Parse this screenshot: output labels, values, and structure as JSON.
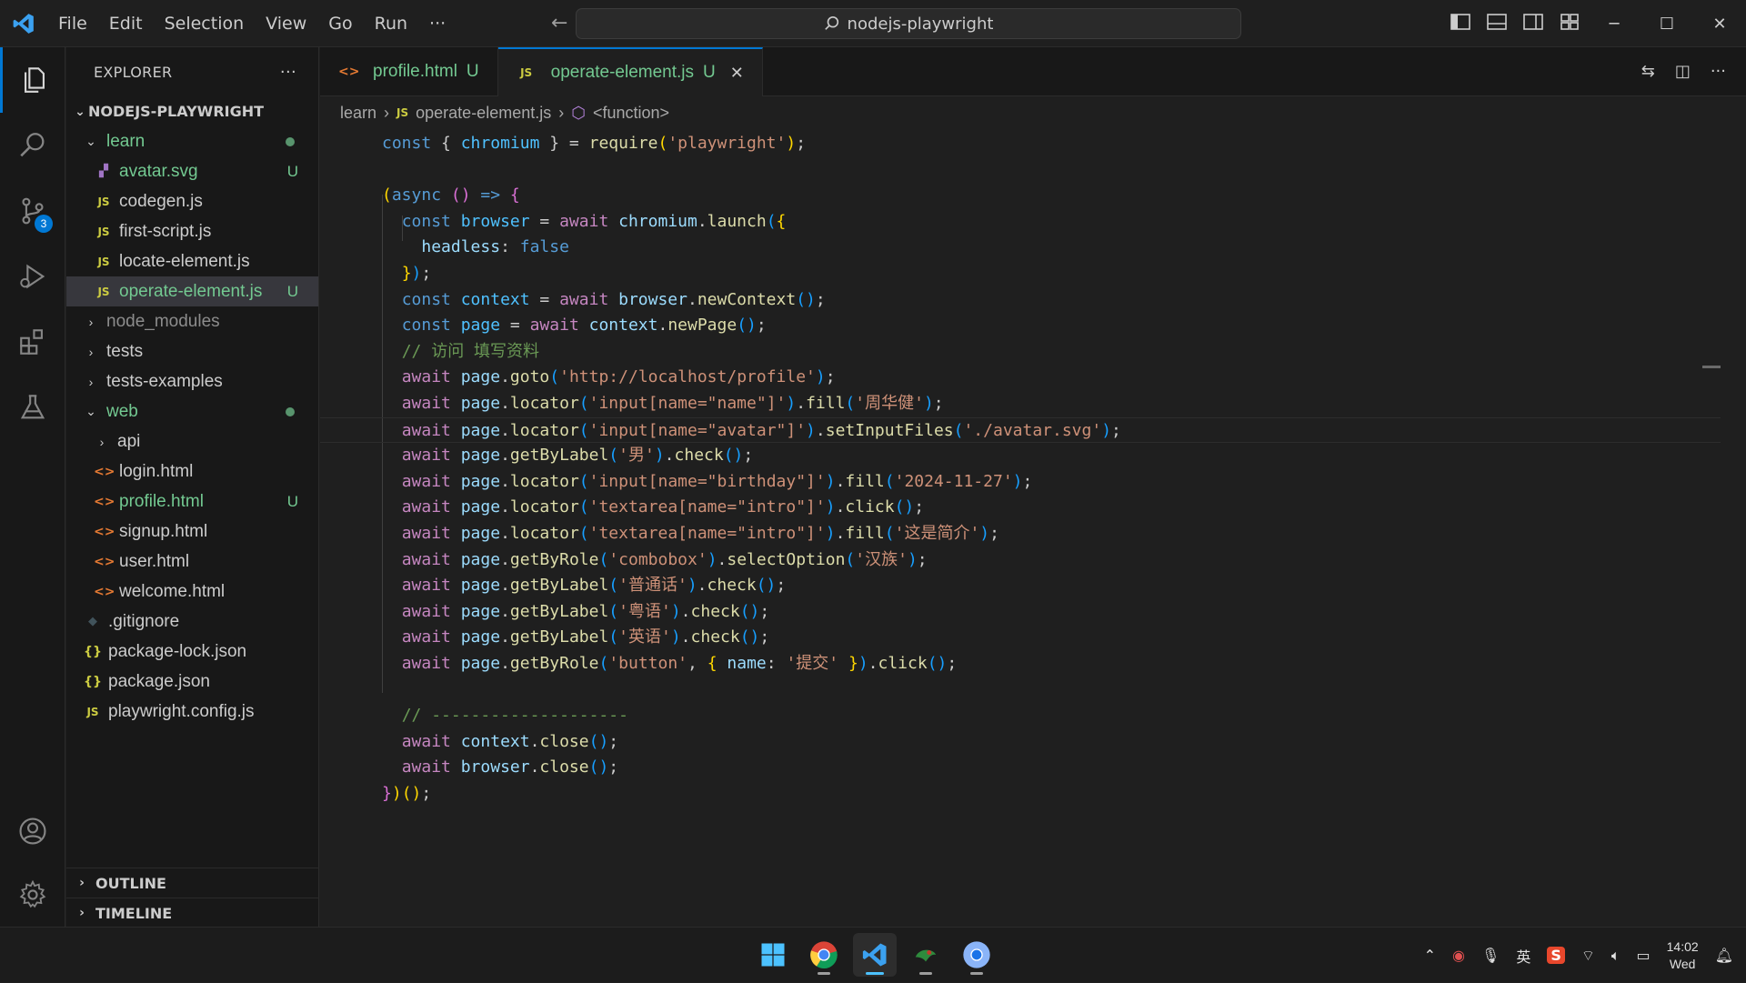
{
  "titlebar": {
    "menu": [
      "File",
      "Edit",
      "Selection",
      "View",
      "Go",
      "Run",
      "···"
    ],
    "search_text": "nodejs-playwright"
  },
  "activity": {
    "scm_badge": "3"
  },
  "explorer": {
    "title": "EXPLORER",
    "more": "···",
    "root": "NODEJS-PLAYWRIGHT",
    "items": [
      {
        "label": "learn",
        "type": "folder-open",
        "depth": 1,
        "status": "dot"
      },
      {
        "label": "avatar.svg",
        "type": "svg",
        "depth": 2,
        "status": "U"
      },
      {
        "label": "codegen.js",
        "type": "js",
        "depth": 2,
        "status": ""
      },
      {
        "label": "first-script.js",
        "type": "js",
        "depth": 2,
        "status": ""
      },
      {
        "label": "locate-element.js",
        "type": "js",
        "depth": 2,
        "status": ""
      },
      {
        "label": "operate-element.js",
        "type": "js",
        "depth": 2,
        "status": "U",
        "selected": true
      },
      {
        "label": "node_modules",
        "type": "folder",
        "depth": 1,
        "status": "",
        "ignored": true
      },
      {
        "label": "tests",
        "type": "folder",
        "depth": 1,
        "status": ""
      },
      {
        "label": "tests-examples",
        "type": "folder",
        "depth": 1,
        "status": ""
      },
      {
        "label": "web",
        "type": "folder-open",
        "depth": 1,
        "status": "dot"
      },
      {
        "label": "api",
        "type": "folder",
        "depth": 2,
        "status": ""
      },
      {
        "label": "login.html",
        "type": "html",
        "depth": 2,
        "status": ""
      },
      {
        "label": "profile.html",
        "type": "html",
        "depth": 2,
        "status": "U"
      },
      {
        "label": "signup.html",
        "type": "html",
        "depth": 2,
        "status": ""
      },
      {
        "label": "user.html",
        "type": "html",
        "depth": 2,
        "status": ""
      },
      {
        "label": "welcome.html",
        "type": "html",
        "depth": 2,
        "status": ""
      },
      {
        "label": ".gitignore",
        "type": "git",
        "depth": 1,
        "status": ""
      },
      {
        "label": "package-lock.json",
        "type": "json",
        "depth": 1,
        "status": ""
      },
      {
        "label": "package.json",
        "type": "json",
        "depth": 1,
        "status": ""
      },
      {
        "label": "playwright.config.js",
        "type": "js",
        "depth": 1,
        "status": ""
      }
    ],
    "outline": "OUTLINE",
    "timeline": "TIMELINE"
  },
  "tabs": [
    {
      "label": "profile.html",
      "status": "U",
      "icon": "html",
      "active": false
    },
    {
      "label": "operate-element.js",
      "status": "U",
      "icon": "js",
      "active": true
    }
  ],
  "breadcrumbs": {
    "folder": "learn",
    "file": "operate-element.js",
    "symbol": "<function>"
  },
  "code_lines": [
    [
      [
        "kw",
        "const "
      ],
      [
        "pn",
        "{ "
      ],
      [
        "cst",
        "chromium"
      ],
      [
        "pn",
        " } = "
      ],
      [
        "fn",
        "require"
      ],
      [
        "br1",
        "("
      ],
      [
        "str",
        "'playwright'"
      ],
      [
        "br1",
        ")"
      ],
      [
        "pn",
        ";"
      ]
    ],
    [],
    [
      [
        "br1",
        "("
      ],
      [
        "kw",
        "async "
      ],
      [
        "br2",
        "()"
      ],
      [
        "kw",
        " => "
      ],
      [
        "br2",
        "{"
      ]
    ],
    [
      [
        "pn",
        "  "
      ],
      [
        "kw",
        "const "
      ],
      [
        "cst",
        "browser"
      ],
      [
        "pn",
        " = "
      ],
      [
        "kw2",
        "await "
      ],
      [
        "var",
        "chromium"
      ],
      [
        "pn",
        "."
      ],
      [
        "fn",
        "launch"
      ],
      [
        "br3",
        "("
      ],
      [
        "br1",
        "{"
      ]
    ],
    [
      [
        "pn",
        "    "
      ],
      [
        "var",
        "headless"
      ],
      [
        "pn",
        ": "
      ],
      [
        "kw",
        "false"
      ]
    ],
    [
      [
        "pn",
        "  "
      ],
      [
        "br1",
        "}"
      ],
      [
        "br3",
        ")"
      ],
      [
        "pn",
        ";"
      ]
    ],
    [
      [
        "pn",
        "  "
      ],
      [
        "kw",
        "const "
      ],
      [
        "cst",
        "context"
      ],
      [
        "pn",
        " = "
      ],
      [
        "kw2",
        "await "
      ],
      [
        "var",
        "browser"
      ],
      [
        "pn",
        "."
      ],
      [
        "fn",
        "newContext"
      ],
      [
        "br3",
        "()"
      ],
      [
        "pn",
        ";"
      ]
    ],
    [
      [
        "pn",
        "  "
      ],
      [
        "kw",
        "const "
      ],
      [
        "cst",
        "page"
      ],
      [
        "pn",
        " = "
      ],
      [
        "kw2",
        "await "
      ],
      [
        "var",
        "context"
      ],
      [
        "pn",
        "."
      ],
      [
        "fn",
        "newPage"
      ],
      [
        "br3",
        "()"
      ],
      [
        "pn",
        ";"
      ]
    ],
    [
      [
        "pn",
        "  "
      ],
      [
        "cm",
        "// 访问 填写资料"
      ]
    ],
    [
      [
        "pn",
        "  "
      ],
      [
        "kw2",
        "await "
      ],
      [
        "var",
        "page"
      ],
      [
        "pn",
        "."
      ],
      [
        "fn",
        "goto"
      ],
      [
        "br3",
        "("
      ],
      [
        "str",
        "'http://localhost/profile'"
      ],
      [
        "br3",
        ")"
      ],
      [
        "pn",
        ";"
      ]
    ],
    [
      [
        "pn",
        "  "
      ],
      [
        "kw2",
        "await "
      ],
      [
        "var",
        "page"
      ],
      [
        "pn",
        "."
      ],
      [
        "fn",
        "locator"
      ],
      [
        "br3",
        "("
      ],
      [
        "str",
        "'input[name=\"name\"]'"
      ],
      [
        "br3",
        ")"
      ],
      [
        "pn",
        "."
      ],
      [
        "fn",
        "fill"
      ],
      [
        "br3",
        "("
      ],
      [
        "str",
        "'周华健'"
      ],
      [
        "br3",
        ")"
      ],
      [
        "pn",
        ";"
      ]
    ],
    [
      [
        "pn",
        "  "
      ],
      [
        "kw2",
        "await "
      ],
      [
        "var",
        "page"
      ],
      [
        "pn",
        "."
      ],
      [
        "fn",
        "locator"
      ],
      [
        "br3",
        "("
      ],
      [
        "str",
        "'input[name=\"avatar\"]'"
      ],
      [
        "br3",
        ")"
      ],
      [
        "pn",
        "."
      ],
      [
        "fn",
        "setInputFiles"
      ],
      [
        "br3",
        "("
      ],
      [
        "str",
        "'./avatar.svg'"
      ],
      [
        "br3",
        ")"
      ],
      [
        "pn",
        ";"
      ]
    ],
    [
      [
        "pn",
        "  "
      ],
      [
        "kw2",
        "await "
      ],
      [
        "var",
        "page"
      ],
      [
        "pn",
        "."
      ],
      [
        "fn",
        "getByLabel"
      ],
      [
        "br3",
        "("
      ],
      [
        "str",
        "'男'"
      ],
      [
        "br3",
        ")"
      ],
      [
        "pn",
        "."
      ],
      [
        "fn",
        "check"
      ],
      [
        "br3",
        "()"
      ],
      [
        "pn",
        ";"
      ]
    ],
    [
      [
        "pn",
        "  "
      ],
      [
        "kw2",
        "await "
      ],
      [
        "var",
        "page"
      ],
      [
        "pn",
        "."
      ],
      [
        "fn",
        "locator"
      ],
      [
        "br3",
        "("
      ],
      [
        "str",
        "'input[name=\"birthday\"]'"
      ],
      [
        "br3",
        ")"
      ],
      [
        "pn",
        "."
      ],
      [
        "fn",
        "fill"
      ],
      [
        "br3",
        "("
      ],
      [
        "str",
        "'2024-11-27'"
      ],
      [
        "br3",
        ")"
      ],
      [
        "pn",
        ";"
      ]
    ],
    [
      [
        "pn",
        "  "
      ],
      [
        "kw2",
        "await "
      ],
      [
        "var",
        "page"
      ],
      [
        "pn",
        "."
      ],
      [
        "fn",
        "locator"
      ],
      [
        "br3",
        "("
      ],
      [
        "str",
        "'textarea[name=\"intro\"]'"
      ],
      [
        "br3",
        ")"
      ],
      [
        "pn",
        "."
      ],
      [
        "fn",
        "click"
      ],
      [
        "br3",
        "()"
      ],
      [
        "pn",
        ";"
      ]
    ],
    [
      [
        "pn",
        "  "
      ],
      [
        "kw2",
        "await "
      ],
      [
        "var",
        "page"
      ],
      [
        "pn",
        "."
      ],
      [
        "fn",
        "locator"
      ],
      [
        "br3",
        "("
      ],
      [
        "str",
        "'textarea[name=\"intro\"]'"
      ],
      [
        "br3",
        ")"
      ],
      [
        "pn",
        "."
      ],
      [
        "fn",
        "fill"
      ],
      [
        "br3",
        "("
      ],
      [
        "str",
        "'这是简介'"
      ],
      [
        "br3",
        ")"
      ],
      [
        "pn",
        ";"
      ]
    ],
    [
      [
        "pn",
        "  "
      ],
      [
        "kw2",
        "await "
      ],
      [
        "var",
        "page"
      ],
      [
        "pn",
        "."
      ],
      [
        "fn",
        "getByRole"
      ],
      [
        "br3",
        "("
      ],
      [
        "str",
        "'combobox'"
      ],
      [
        "br3",
        ")"
      ],
      [
        "pn",
        "."
      ],
      [
        "fn",
        "selectOption"
      ],
      [
        "br3",
        "("
      ],
      [
        "str",
        "'汉族'"
      ],
      [
        "br3",
        ")"
      ],
      [
        "pn",
        ";"
      ]
    ],
    [
      [
        "pn",
        "  "
      ],
      [
        "kw2",
        "await "
      ],
      [
        "var",
        "page"
      ],
      [
        "pn",
        "."
      ],
      [
        "fn",
        "getByLabel"
      ],
      [
        "br3",
        "("
      ],
      [
        "str",
        "'普通话'"
      ],
      [
        "br3",
        ")"
      ],
      [
        "pn",
        "."
      ],
      [
        "fn",
        "check"
      ],
      [
        "br3",
        "()"
      ],
      [
        "pn",
        ";"
      ]
    ],
    [
      [
        "pn",
        "  "
      ],
      [
        "kw2",
        "await "
      ],
      [
        "var",
        "page"
      ],
      [
        "pn",
        "."
      ],
      [
        "fn",
        "getByLabel"
      ],
      [
        "br3",
        "("
      ],
      [
        "str",
        "'粤语'"
      ],
      [
        "br3",
        ")"
      ],
      [
        "pn",
        "."
      ],
      [
        "fn",
        "check"
      ],
      [
        "br3",
        "()"
      ],
      [
        "pn",
        ";"
      ]
    ],
    [
      [
        "pn",
        "  "
      ],
      [
        "kw2",
        "await "
      ],
      [
        "var",
        "page"
      ],
      [
        "pn",
        "."
      ],
      [
        "fn",
        "getByLabel"
      ],
      [
        "br3",
        "("
      ],
      [
        "str",
        "'英语'"
      ],
      [
        "br3",
        ")"
      ],
      [
        "pn",
        "."
      ],
      [
        "fn",
        "check"
      ],
      [
        "br3",
        "()"
      ],
      [
        "pn",
        ";"
      ]
    ],
    [
      [
        "pn",
        "  "
      ],
      [
        "kw2",
        "await "
      ],
      [
        "var",
        "page"
      ],
      [
        "pn",
        "."
      ],
      [
        "fn",
        "getByRole"
      ],
      [
        "br3",
        "("
      ],
      [
        "str",
        "'button'"
      ],
      [
        "pn",
        ", "
      ],
      [
        "br1",
        "{ "
      ],
      [
        "var",
        "name"
      ],
      [
        "pn",
        ": "
      ],
      [
        "str",
        "'提交'"
      ],
      [
        "br1",
        " }"
      ],
      [
        "br3",
        ")"
      ],
      [
        "pn",
        "."
      ],
      [
        "fn",
        "click"
      ],
      [
        "br3",
        "()"
      ],
      [
        "pn",
        ";"
      ]
    ],
    [],
    [
      [
        "pn",
        "  "
      ],
      [
        "cm",
        "// --------------------"
      ]
    ],
    [
      [
        "pn",
        "  "
      ],
      [
        "kw2",
        "await "
      ],
      [
        "var",
        "context"
      ],
      [
        "pn",
        "."
      ],
      [
        "fn",
        "close"
      ],
      [
        "br3",
        "()"
      ],
      [
        "pn",
        ";"
      ]
    ],
    [
      [
        "pn",
        "  "
      ],
      [
        "kw2",
        "await "
      ],
      [
        "var",
        "browser"
      ],
      [
        "pn",
        "."
      ],
      [
        "fn",
        "close"
      ],
      [
        "br3",
        "()"
      ],
      [
        "pn",
        ";"
      ]
    ],
    [
      [
        "br2",
        "}"
      ],
      [
        "br1",
        ")"
      ],
      [
        "br1",
        "()"
      ],
      [
        "pn",
        ";"
      ]
    ]
  ],
  "current_line": 11,
  "taskbar": {
    "ime": "英",
    "time": "14:02",
    "day": "Wed"
  }
}
